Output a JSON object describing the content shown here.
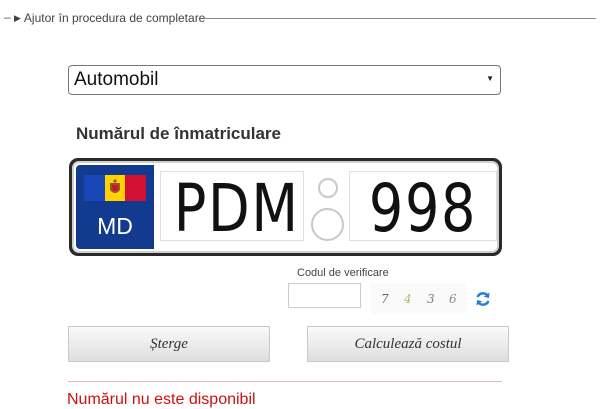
{
  "help": {
    "dash": "–",
    "label": "Ajutor în procedura de completare"
  },
  "vehicle_select": {
    "selected": "Automobil"
  },
  "section_title": "Numărul de înmatriculare",
  "plate": {
    "country_code": "MD",
    "letters": "PDM",
    "digits": "998"
  },
  "verification": {
    "label": "Codul de verificare",
    "captcha_chars": [
      "7",
      "4",
      "3",
      "6"
    ]
  },
  "buttons": {
    "clear": "Șterge",
    "calculate": "Calculează costul"
  },
  "error": "Numărul nu este disponibil",
  "colors": {
    "plate_blue": "#123b8f",
    "error_red": "#cc1111",
    "refresh_blue": "#1e7fd8"
  },
  "icons": {
    "dropdown": "caret-down-icon",
    "refresh": "refresh-icon",
    "help": "triangle-right-icon"
  }
}
